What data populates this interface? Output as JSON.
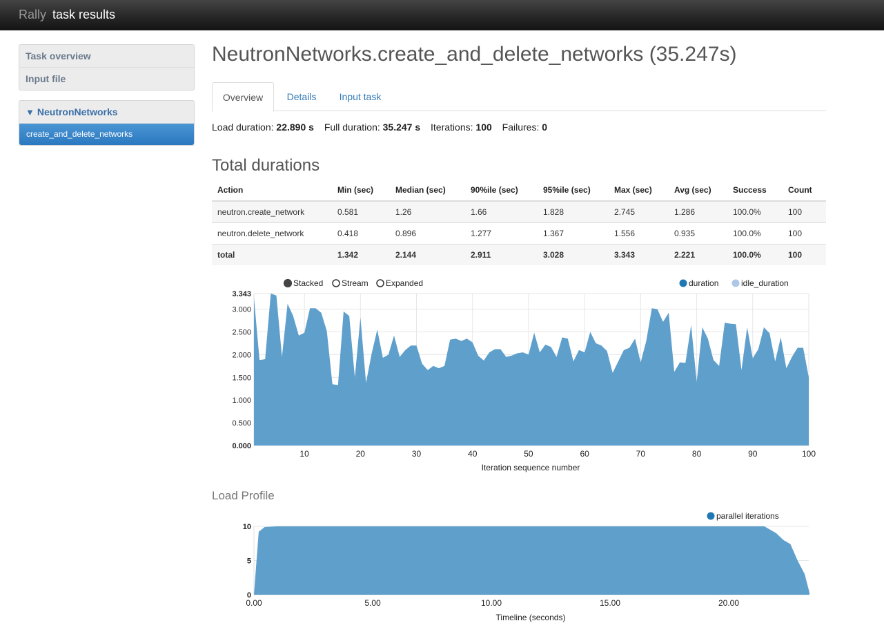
{
  "header": {
    "brand": "Rally",
    "title": "task results"
  },
  "sidebar": {
    "nav": [
      {
        "label": "Task overview"
      },
      {
        "label": "Input file"
      }
    ],
    "groups": [
      {
        "caret": "▼",
        "label": "NeutronNetworks",
        "items": [
          {
            "label": "create_and_delete_networks"
          }
        ]
      }
    ]
  },
  "main": {
    "title": "NeutronNetworks.create_and_delete_networks (35.247s)",
    "tabs": [
      {
        "label": "Overview",
        "active": true
      },
      {
        "label": "Details"
      },
      {
        "label": "Input task"
      }
    ],
    "stats": {
      "load_label": "Load duration:",
      "load_value": "22.890 s",
      "full_label": "Full duration:",
      "full_value": "35.247 s",
      "iter_label": "Iterations:",
      "iter_value": "100",
      "fail_label": "Failures:",
      "fail_value": "0"
    },
    "durations_title": "Total durations",
    "table": {
      "headers": [
        "Action",
        "Min (sec)",
        "Median (sec)",
        "90%ile (sec)",
        "95%ile (sec)",
        "Max (sec)",
        "Avg (sec)",
        "Success",
        "Count"
      ],
      "rows": [
        [
          "neutron.create_network",
          "0.581",
          "1.26",
          "1.66",
          "1.828",
          "2.745",
          "1.286",
          "100.0%",
          "100"
        ],
        [
          "neutron.delete_network",
          "0.418",
          "0.896",
          "1.277",
          "1.367",
          "1.556",
          "0.935",
          "100.0%",
          "100"
        ],
        [
          "total",
          "1.342",
          "2.144",
          "2.911",
          "3.028",
          "3.343",
          "2.221",
          "100.0%",
          "100"
        ]
      ]
    },
    "load_profile_title": "Load Profile"
  },
  "chart_data": [
    {
      "type": "area",
      "title": "",
      "xlabel": "Iteration sequence number",
      "ylabel": "",
      "modes": [
        "Stacked",
        "Stream",
        "Expanded"
      ],
      "selected_mode": "Stacked",
      "legend": [
        "duration",
        "idle_duration"
      ],
      "legend_colors": [
        "#1f77b4",
        "#aec7e8"
      ],
      "fill_color": "#5f9fcc",
      "xlim": [
        1,
        100
      ],
      "ylim": [
        0,
        3.343
      ],
      "x_ticks": [
        10,
        20,
        30,
        40,
        50,
        60,
        70,
        80,
        90,
        100
      ],
      "y_ticks": [
        "0.000",
        "0.500",
        "1.000",
        "1.500",
        "2.000",
        "2.500",
        "3.000",
        "3.343"
      ],
      "series": [
        {
          "name": "duration",
          "values": [
            3.25,
            1.88,
            1.9,
            3.343,
            3.3,
            1.95,
            3.12,
            2.85,
            2.42,
            2.48,
            3.02,
            3.02,
            2.92,
            2.52,
            1.35,
            1.33,
            2.95,
            2.85,
            1.5,
            2.82,
            1.38,
            2.02,
            2.55,
            1.93,
            2.0,
            2.42,
            1.95,
            2.1,
            2.2,
            2.2,
            1.8,
            1.66,
            1.75,
            1.7,
            1.75,
            2.33,
            2.35,
            2.3,
            2.35,
            2.27,
            1.98,
            1.87,
            2.05,
            2.12,
            2.12,
            1.95,
            1.98,
            2.03,
            2.05,
            2.0,
            2.48,
            2.05,
            2.22,
            2.17,
            1.95,
            2.38,
            2.35,
            1.85,
            2.1,
            2.05,
            2.5,
            2.25,
            2.2,
            2.08,
            1.6,
            1.85,
            2.1,
            2.15,
            2.35,
            1.83,
            2.3,
            3.02,
            3.0,
            2.72,
            2.92,
            1.62,
            1.83,
            1.82,
            2.65,
            1.4,
            2.6,
            2.35,
            1.88,
            1.75,
            2.7,
            2.68,
            2.67,
            1.66,
            2.6,
            1.92,
            2.12,
            2.6,
            2.47,
            1.85,
            2.38,
            1.7,
            1.95,
            2.15,
            2.15,
            1.5
          ]
        }
      ]
    },
    {
      "type": "area",
      "title": "Load Profile",
      "xlabel": "Timeline (seconds)",
      "ylabel": "",
      "legend": [
        "parallel iterations"
      ],
      "legend_colors": [
        "#1f77b4"
      ],
      "fill_color": "#5f9fcc",
      "xlim": [
        0,
        23.4
      ],
      "ylim": [
        0,
        10
      ],
      "x_ticks": [
        "0.00",
        "5.00",
        "10.00",
        "15.00",
        "20.00"
      ],
      "y_ticks": [
        "0",
        "5",
        "10"
      ],
      "series": [
        {
          "name": "parallel iterations",
          "x": [
            0,
            0.2,
            0.45,
            1,
            2,
            3,
            4,
            5,
            6,
            7,
            8,
            9,
            10,
            11,
            12,
            13,
            14,
            15,
            16,
            17,
            18,
            19,
            20,
            21,
            21.5,
            22.0,
            22.3,
            22.6,
            22.9,
            23.2,
            23.4
          ],
          "values": [
            0,
            9.2,
            9.9,
            10,
            10,
            10,
            10,
            10,
            10,
            10,
            10,
            10,
            10,
            10,
            10,
            10,
            10,
            10,
            10,
            10,
            10,
            10,
            10,
            10,
            10,
            9.0,
            8.0,
            7.4,
            5.0,
            3.0,
            0.3
          ]
        }
      ]
    }
  ]
}
